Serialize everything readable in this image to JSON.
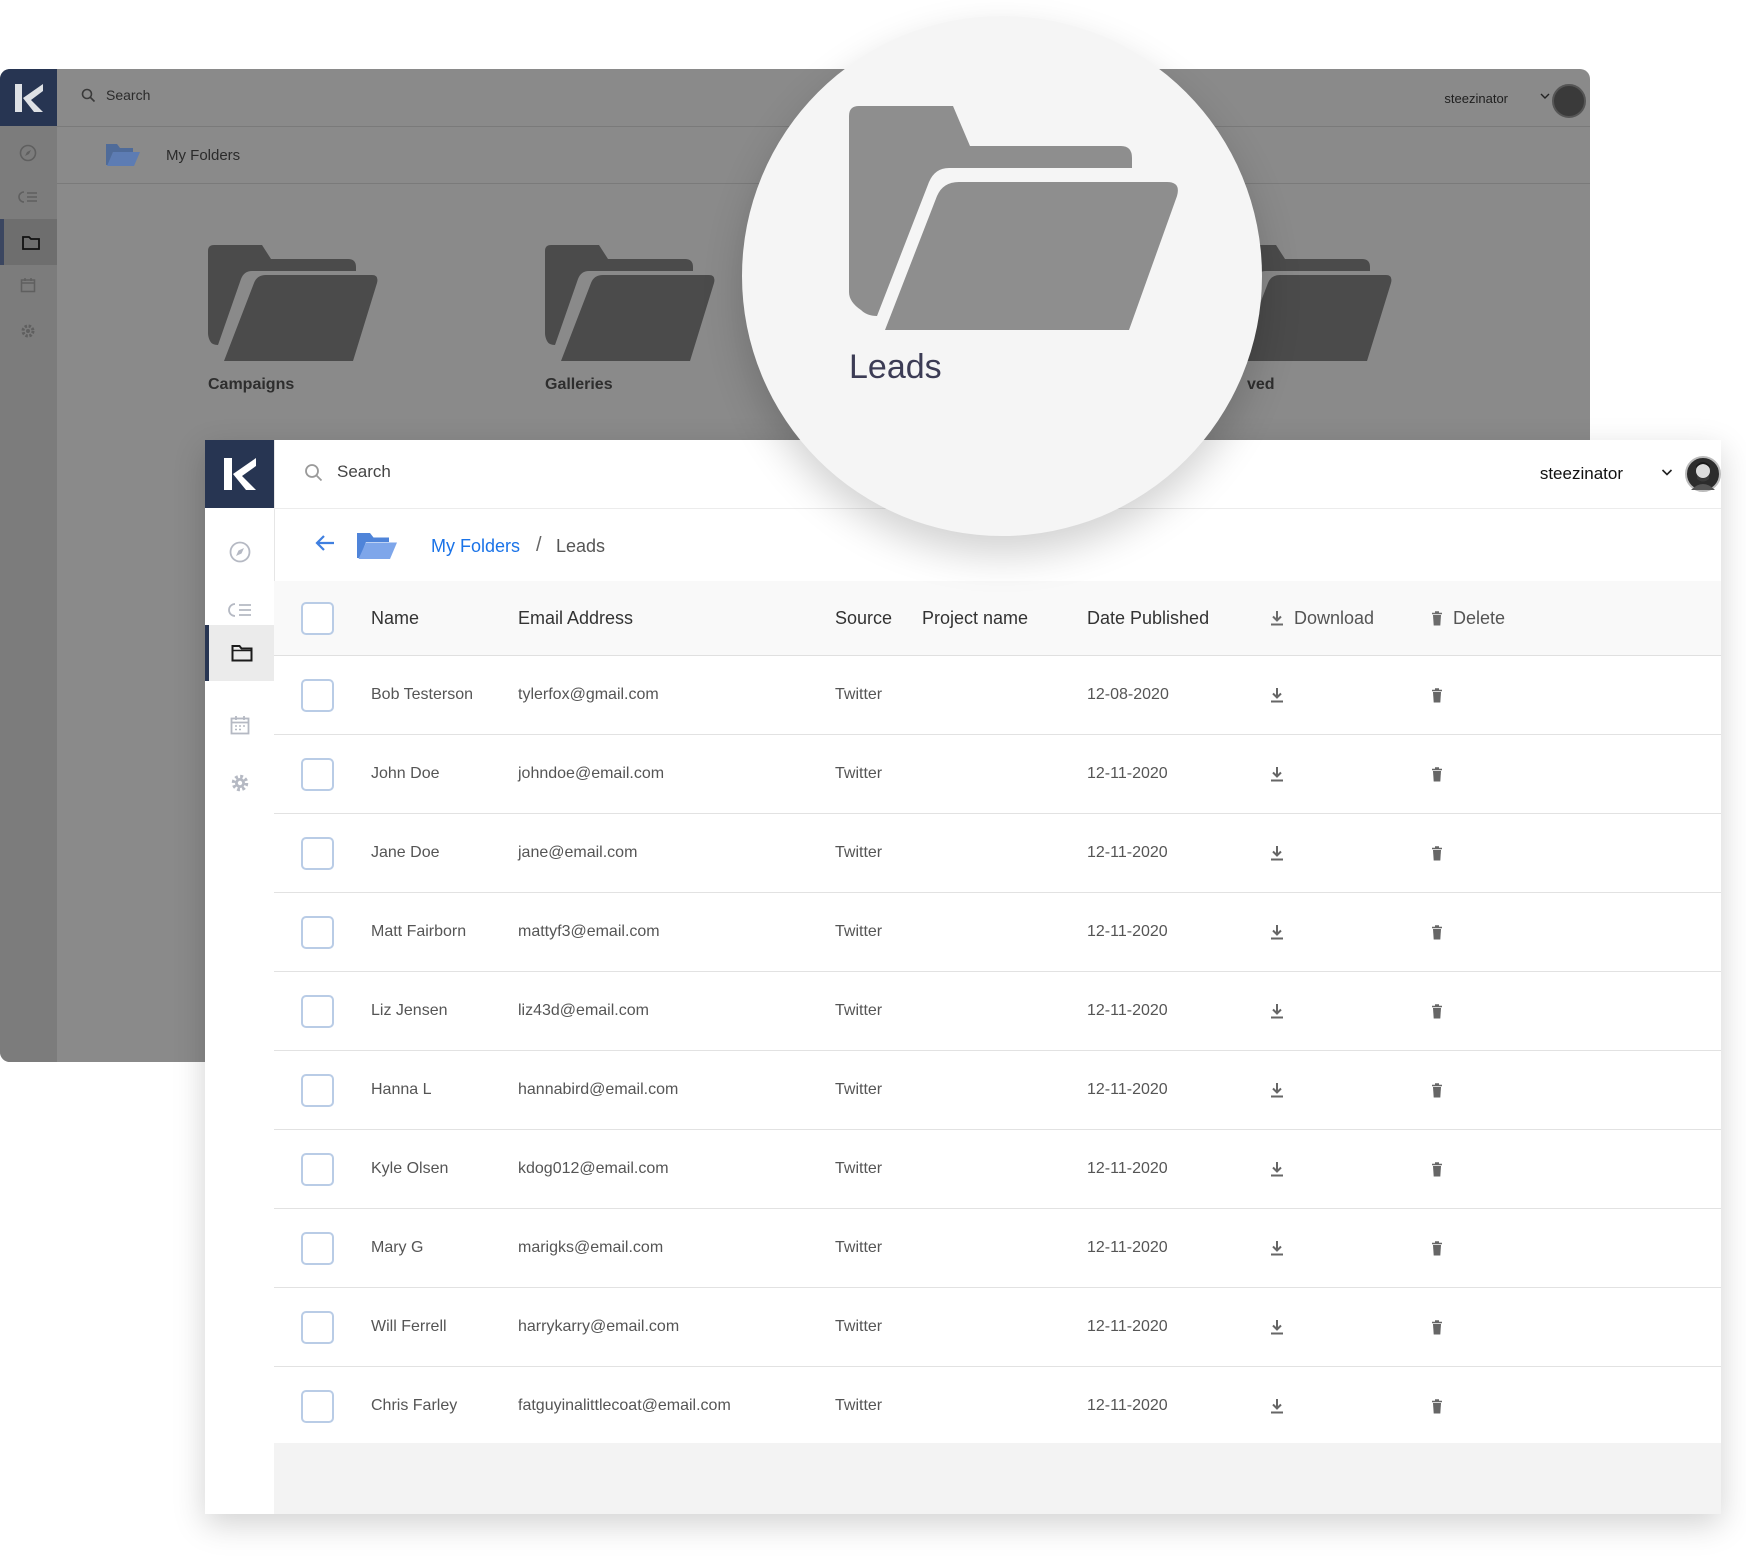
{
  "background_window": {
    "search_label": "Search",
    "username": "steezinator",
    "breadcrumb": "My Folders",
    "folders": [
      "Campaigns",
      "Galleries",
      "ved"
    ]
  },
  "magnifier": {
    "folder_label": "Leads"
  },
  "app": {
    "search_placeholder": "Search",
    "username": "steezinator"
  },
  "breadcrumb": {
    "root": "My Folders",
    "separator": "/",
    "current": "Leads"
  },
  "table": {
    "headers": {
      "name": "Name",
      "email": "Email Address",
      "source": "Source",
      "project": "Project name",
      "date": "Date Published",
      "download": "Download",
      "delete": "Delete"
    },
    "rows": [
      {
        "name": "Bob Testerson",
        "email": "tylerfox@gmail.com",
        "source": "Twitter",
        "project": "",
        "date": "12-08-2020"
      },
      {
        "name": "John Doe",
        "email": "johndoe@email.com",
        "source": "Twitter",
        "project": "",
        "date": "12-11-2020"
      },
      {
        "name": "Jane Doe",
        "email": "jane@email.com",
        "source": "Twitter",
        "project": "",
        "date": "12-11-2020"
      },
      {
        "name": "Matt Fairborn",
        "email": "mattyf3@email.com",
        "source": "Twitter",
        "project": "",
        "date": "12-11-2020"
      },
      {
        "name": "Liz Jensen",
        "email": "liz43d@email.com",
        "source": "Twitter",
        "project": "",
        "date": "12-11-2020"
      },
      {
        "name": "Hanna L",
        "email": "hannabird@email.com",
        "source": "Twitter",
        "project": "",
        "date": "12-11-2020"
      },
      {
        "name": "Kyle Olsen",
        "email": "kdog012@email.com",
        "source": "Twitter",
        "project": "",
        "date": "12-11-2020"
      },
      {
        "name": "Mary G",
        "email": "marigks@email.com",
        "source": "Twitter",
        "project": "",
        "date": "12-11-2020"
      },
      {
        "name": "Will Ferrell",
        "email": "harrykarry@email.com",
        "source": "Twitter",
        "project": "",
        "date": "12-11-2020"
      },
      {
        "name": "Chris Farley",
        "email": "fatguyinalittlecoat@email.com",
        "source": "Twitter",
        "project": "",
        "date": "12-11-2020"
      }
    ]
  },
  "colors": {
    "brand_navy": "#273552",
    "link_blue": "#1a73e8",
    "folder_blue": "#6f9be6",
    "checkbox_border": "#b9cce6"
  }
}
